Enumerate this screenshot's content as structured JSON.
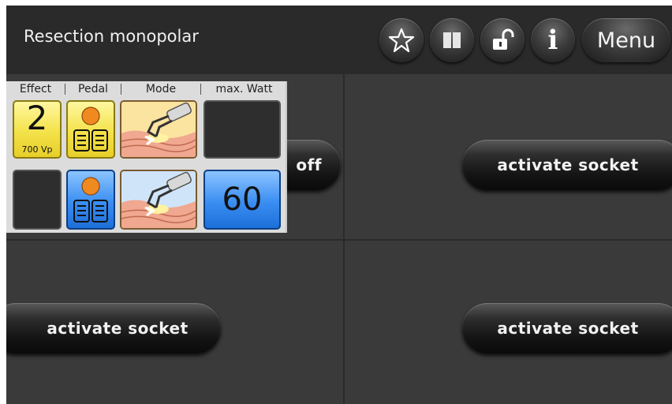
{
  "header": {
    "title": "Resection monopolar",
    "buttons": [
      {
        "icon": "star-icon"
      },
      {
        "icon": "book-icon"
      },
      {
        "icon": "unlock-icon"
      },
      {
        "icon": "info-icon",
        "label": "i"
      }
    ],
    "menu_label": "Menu"
  },
  "panel": {
    "columns": [
      "Effect",
      "Pedal",
      "Mode",
      "max. Watt"
    ],
    "row1": {
      "effect_value": "2",
      "effect_sub": "700 Vp",
      "pedal_color": "yellow",
      "watt": ""
    },
    "row2": {
      "effect_value": "",
      "pedal_color": "blue",
      "watt": "60"
    }
  },
  "sockets": {
    "top_left_label": "off",
    "top_right_label": "activate socket",
    "bottom_left_label": "activate socket",
    "bottom_right_label": "activate socket"
  },
  "colors": {
    "yellow_tile": "#f4e24a",
    "blue_tile": "#3a8ef2",
    "background": "#3a3a3a",
    "header": "#2a2a2a"
  }
}
